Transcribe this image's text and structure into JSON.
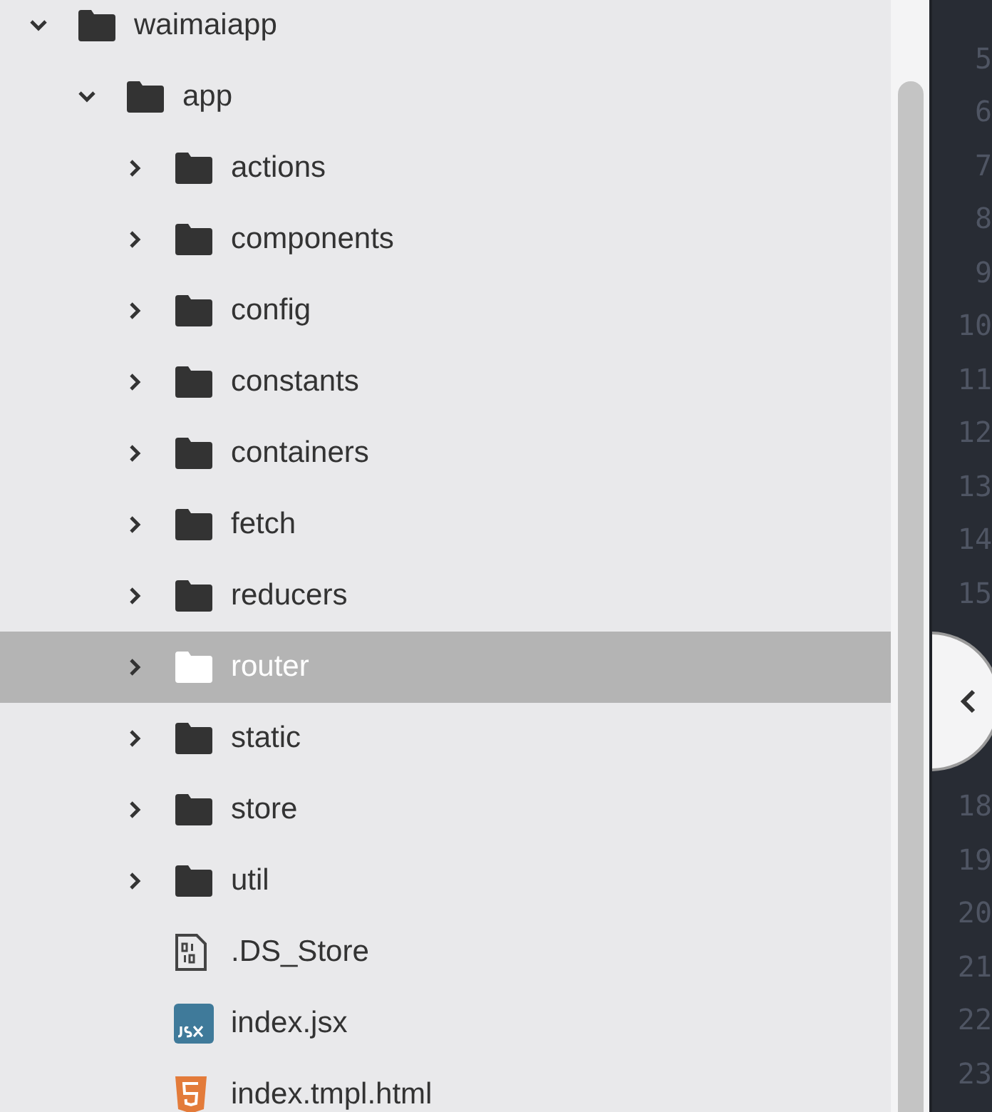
{
  "tree": [
    {
      "kind": "folder",
      "name": "waimaiapp",
      "expanded": true,
      "selected": false,
      "children": [
        {
          "kind": "folder",
          "name": "app",
          "expanded": true,
          "selected": false,
          "children": [
            {
              "kind": "folder",
              "name": "actions",
              "expanded": false,
              "selected": false
            },
            {
              "kind": "folder",
              "name": "components",
              "expanded": false,
              "selected": false
            },
            {
              "kind": "folder",
              "name": "config",
              "expanded": false,
              "selected": false
            },
            {
              "kind": "folder",
              "name": "constants",
              "expanded": false,
              "selected": false
            },
            {
              "kind": "folder",
              "name": "containers",
              "expanded": false,
              "selected": false
            },
            {
              "kind": "folder",
              "name": "fetch",
              "expanded": false,
              "selected": false
            },
            {
              "kind": "folder",
              "name": "reducers",
              "expanded": false,
              "selected": false
            },
            {
              "kind": "folder",
              "name": "router",
              "expanded": false,
              "selected": true
            },
            {
              "kind": "folder",
              "name": "static",
              "expanded": false,
              "selected": false
            },
            {
              "kind": "folder",
              "name": "store",
              "expanded": false,
              "selected": false
            },
            {
              "kind": "folder",
              "name": "util",
              "expanded": false,
              "selected": false
            },
            {
              "kind": "binary",
              "name": ".DS_Store",
              "selected": false
            },
            {
              "kind": "jsx",
              "name": "index.jsx",
              "selected": false
            },
            {
              "kind": "html",
              "name": "index.tmpl.html",
              "selected": false
            }
          ]
        }
      ]
    }
  ],
  "editor": {
    "line_numbers_above": [
      "5",
      "6",
      "7",
      "8",
      "9",
      "10",
      "11",
      "12",
      "13",
      "14",
      "15"
    ],
    "line_numbers_below": [
      "18",
      "19",
      "20",
      "21",
      "22",
      "23"
    ]
  }
}
